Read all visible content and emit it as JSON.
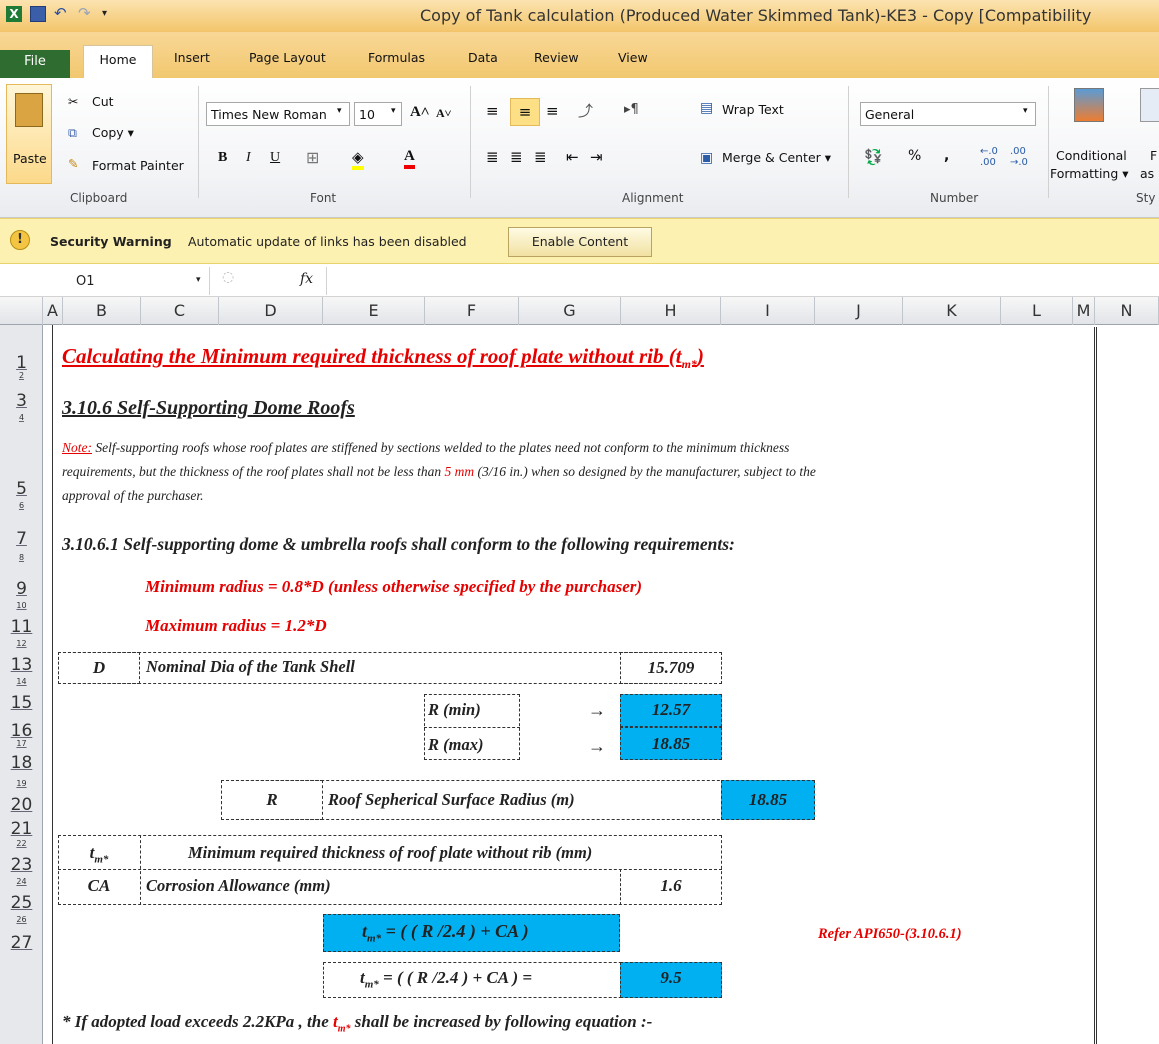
{
  "window": {
    "title": "Copy of Tank calculation (Produced Water Skimmed Tank)-KE3 - Copy  [Compatibility"
  },
  "ribbon_tabs": [
    "File",
    "Home",
    "Insert",
    "Page Layout",
    "Formulas",
    "Data",
    "Review",
    "View"
  ],
  "ribbon": {
    "clipboard": {
      "paste": "Paste",
      "cut": "Cut",
      "copy": "Copy ▾",
      "format_painter": "Format Painter",
      "label": "Clipboard"
    },
    "font": {
      "name": "Times New Roman",
      "size": "10",
      "label": "Font"
    },
    "alignment": {
      "wrap": "Wrap Text",
      "merge": "Merge & Center ▾",
      "label": "Alignment"
    },
    "number": {
      "format": "General",
      "label": "Number"
    },
    "styles": {
      "conditional": "Conditional",
      "formatting": "Formatting ▾",
      "as": "as",
      "f": "F",
      "label": "Sty"
    }
  },
  "security": {
    "title": "Security Warning",
    "message": "Automatic update of links has been disabled",
    "button": "Enable Content"
  },
  "formula_bar": {
    "cell": "O1",
    "fx": "fx"
  },
  "columns": [
    "A",
    "B",
    "C",
    "D",
    "E",
    "F",
    "G",
    "H",
    "I",
    "J",
    "K",
    "L",
    "M",
    "N"
  ],
  "rows": [
    "1",
    "2",
    "3",
    "4",
    "5",
    "6",
    "7",
    "8",
    "9",
    "10",
    "11",
    "12",
    "13",
    "14",
    "15",
    "16",
    "17",
    "18",
    "19",
    "20",
    "21",
    "22",
    "23",
    "24",
    "25",
    "26",
    "27"
  ],
  "sheet": {
    "heading": "Calculating the Minimum required thickness of roof plate without rib",
    "heading_sym": "(t",
    "heading_sub": "m*",
    "heading_end": ")",
    "section": "3.10.6 Self-Supporting Dome Roofs",
    "note_label": "Note:",
    "note_line1": " Self-supporting roofs whose roof plates are stiffened by sections welded to the plates need not conform to the minimum thickness",
    "note_line2a": "requirements, but the thickness of the roof plates shall not be less than ",
    "note_red": "5 mm",
    "note_line2b": " (3/16 in.) when so designed by the manufacturer, subject to the",
    "note_line3": "approval of the purchaser.",
    "req_title": "3.10.6.1 Self-supporting dome & umbrella roofs shall conform to the following requirements:",
    "min_radius": "Minimum radius = 0.8*D (unless otherwise specified by the purchaser)",
    "max_radius": "Maximum radius = 1.2*D",
    "d_sym": "D",
    "d_label": "Nominal Dia of the Tank Shell",
    "d_value": "15.709",
    "rmin_label": "R (min)",
    "rmax_label": "R (max)",
    "arrow": "→",
    "rmin_value": "12.57",
    "rmax_value": "18.85",
    "r_sym": "R",
    "r_label": "Roof  Sepherical Surface Radius (m)",
    "r_value": "18.85",
    "tm_sym": "t",
    "tm_sub": "m*",
    "tm_label": "Minimum required thickness of roof plate without rib (mm)",
    "ca_sym": "CA",
    "ca_label": "Corrosion Allowance (mm)",
    "ca_value": "1.6",
    "formula_t": "t",
    "formula_sub": "m*",
    "formula_rest": " = ( ( R /2.4 ) + CA )",
    "formula2_rest": " = ( ( R /2.4 ) + CA ) =",
    "formula_value": "9.5",
    "refer": "Refer API650-(3.10.6.1)",
    "foot_a": "* If adopted load exceeds 2.2KPa , the ",
    "foot_t": "t",
    "foot_sub": "m*",
    "foot_b": " shall be increased by following equation :-"
  }
}
